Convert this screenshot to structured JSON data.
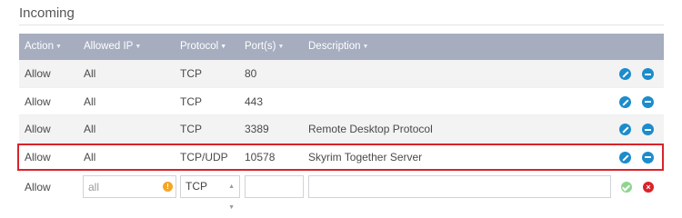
{
  "panel": {
    "title": "Incoming"
  },
  "columns": [
    {
      "label": "Action",
      "sort_icon": "sort-caret-icon",
      "active": false
    },
    {
      "label": "Allowed IP",
      "sort_icon": "sort-caret-icon",
      "active": false
    },
    {
      "label": "Protocol",
      "sort_icon": "sort-caret-icon",
      "active": true
    },
    {
      "label": "Port(s)",
      "sort_icon": "sort-caret-icon",
      "active": false
    },
    {
      "label": "Description",
      "sort_icon": "sort-caret-icon",
      "active": false
    }
  ],
  "rules": [
    {
      "action": "Allow",
      "ip": "All",
      "protocol": "TCP",
      "port": "80",
      "description": ""
    },
    {
      "action": "Allow",
      "ip": "All",
      "protocol": "TCP",
      "port": "443",
      "description": ""
    },
    {
      "action": "Allow",
      "ip": "All",
      "protocol": "TCP",
      "port": "3389",
      "description": "Remote Desktop Protocol"
    },
    {
      "action": "Allow",
      "ip": "All",
      "protocol": "TCP/UDP",
      "port": "10578",
      "description": "Skyrim Together Server"
    }
  ],
  "new_rule": {
    "action": "Allow",
    "ip_placeholder": "all",
    "protocol_selected": "TCP",
    "port_value": "",
    "description_value": ""
  },
  "highlighted_rule_index": 3,
  "colors": {
    "header_bg": "#a5adbf",
    "action_icon": "#1b8ccc",
    "highlight_border": "#d9232a",
    "confirm": "#8fd48f",
    "cancel": "#d9232a",
    "warning": "#f5a623"
  }
}
